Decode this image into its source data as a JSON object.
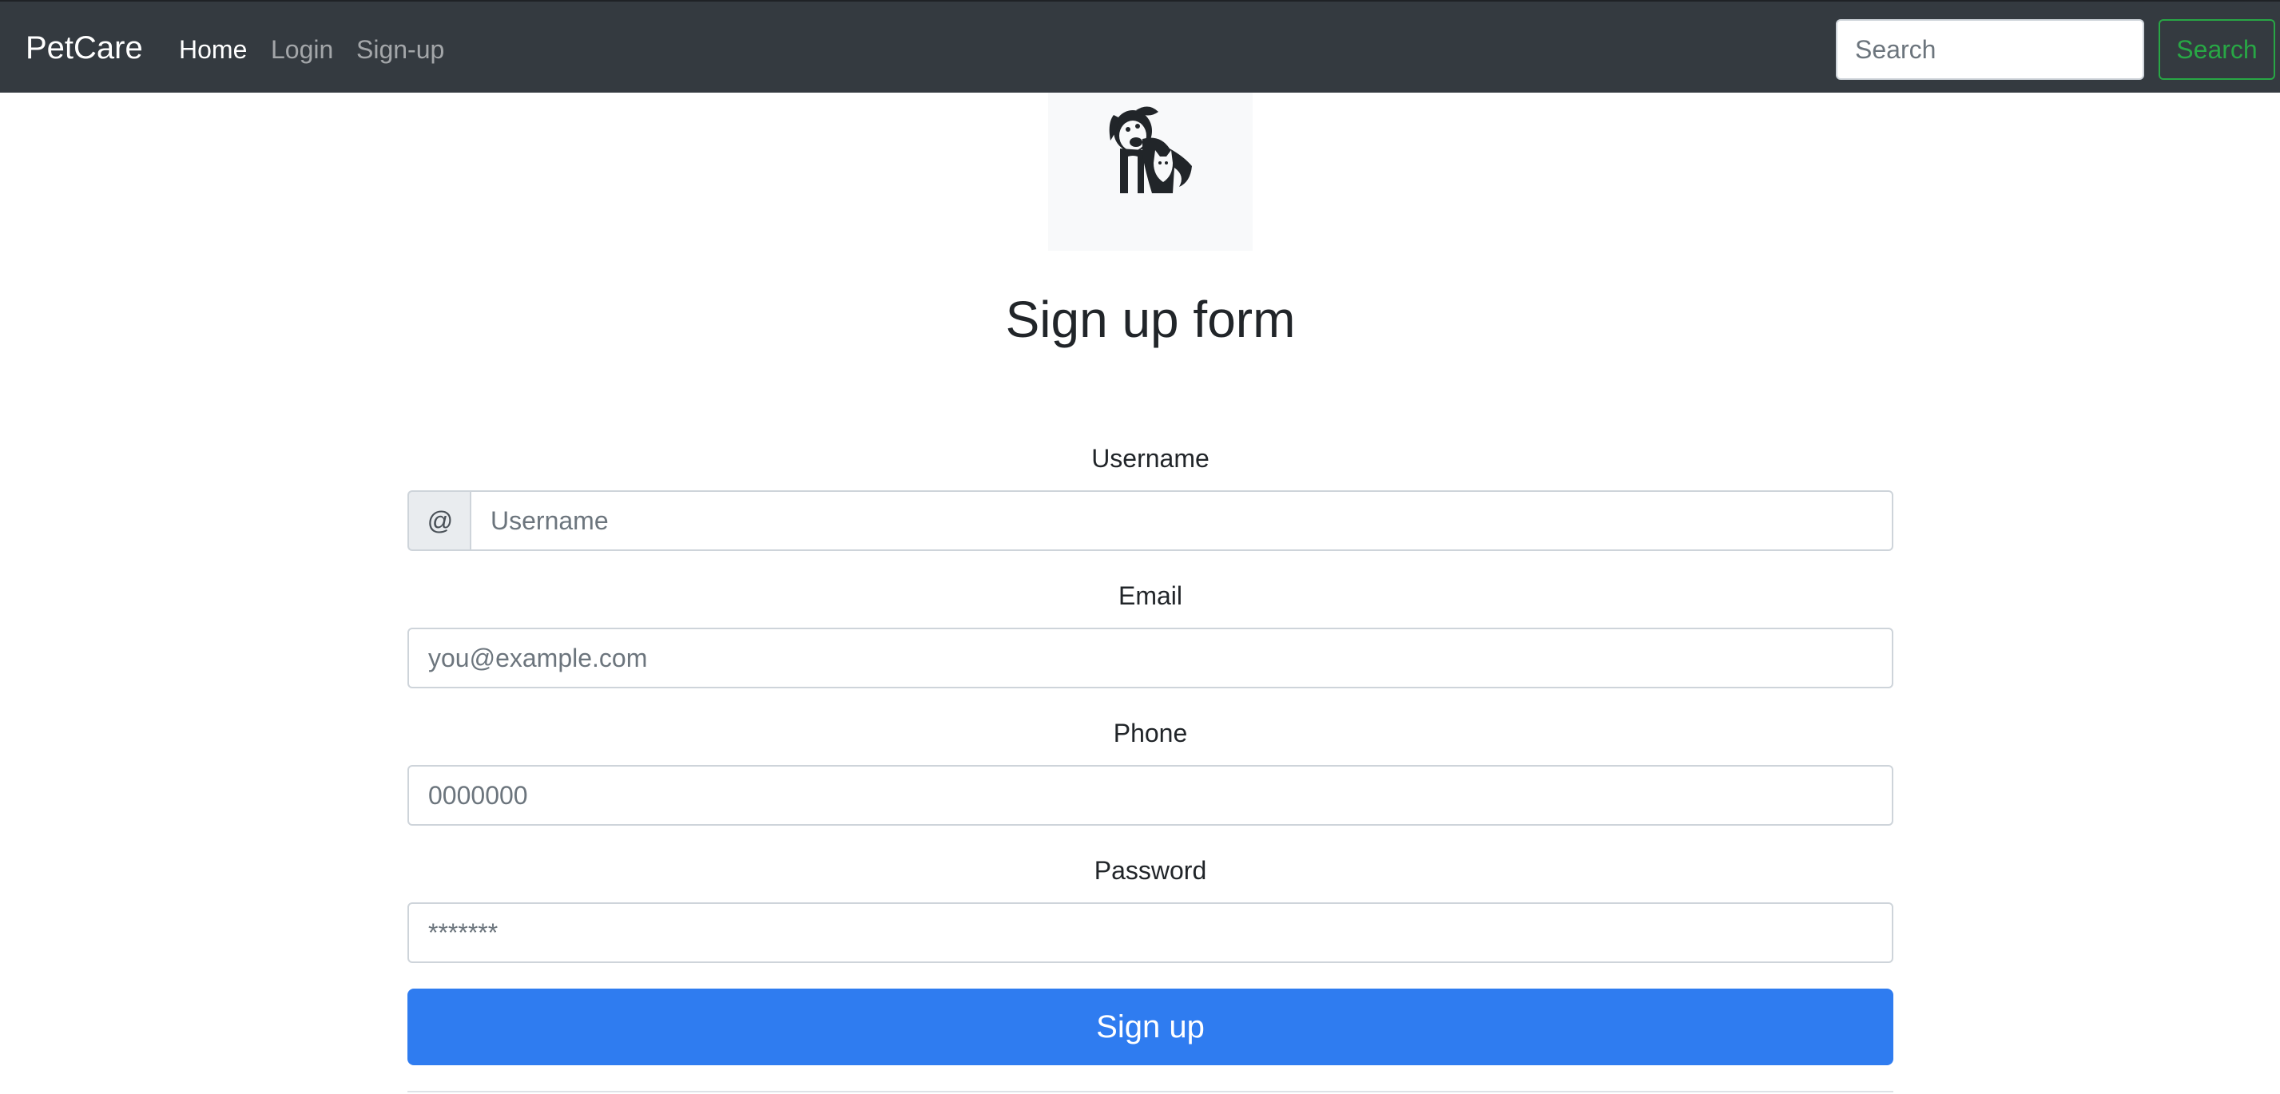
{
  "navbar": {
    "brand": "PetCare",
    "links": [
      {
        "label": "Home",
        "active": true
      },
      {
        "label": "Login",
        "active": false
      },
      {
        "label": "Sign-up",
        "active": false
      }
    ],
    "search": {
      "placeholder": "Search",
      "button_label": "Search"
    }
  },
  "logo": {
    "icon": "dog-cat-logo-icon"
  },
  "page": {
    "title": "Sign up form"
  },
  "form": {
    "username": {
      "label": "Username",
      "prefix": "@",
      "placeholder": "Username"
    },
    "email": {
      "label": "Email",
      "placeholder": "you@example.com"
    },
    "phone": {
      "label": "Phone",
      "placeholder": "0000000"
    },
    "password": {
      "label": "Password",
      "placeholder": "*******"
    },
    "submit_label": "Sign up"
  },
  "colors": {
    "navbar_bg": "#343a40",
    "search_button": "#28a745",
    "primary_button": "#2f7cf0"
  }
}
